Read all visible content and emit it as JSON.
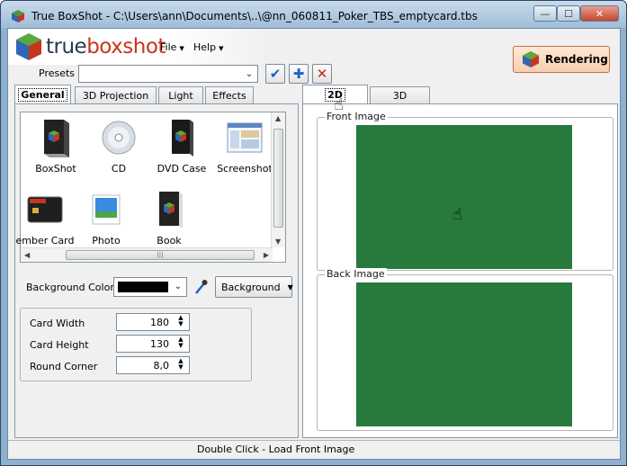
{
  "window": {
    "title": "True BoxShot - C:\\Users\\ann\\Documents\\..\\@nn_060811_Poker_TBS_emptycard.tbs",
    "controls": {
      "minimize": "—",
      "maximize": "☐",
      "close": "✕"
    }
  },
  "logo": {
    "part1": "true",
    "part2": "boxshot"
  },
  "menu": {
    "file": "File",
    "help": "Help"
  },
  "presets": {
    "label": "Presets",
    "value": ""
  },
  "toolbar": {
    "apply_icon": "check-icon",
    "add_icon": "plus-icon",
    "delete_icon": "x-icon"
  },
  "render_button": {
    "label": "Rendering"
  },
  "left_tabs": [
    "General",
    "3D Projection",
    "Light",
    "Effects"
  ],
  "templates": [
    {
      "label": "BoxShot",
      "icon": "boxshot-icon"
    },
    {
      "label": "CD",
      "icon": "cd-icon"
    },
    {
      "label": "DVD Case",
      "icon": "dvd-case-icon"
    },
    {
      "label": "Screenshot",
      "icon": "screenshot-icon"
    },
    {
      "label": "ember Card",
      "icon": "member-card-icon"
    },
    {
      "label": "Photo",
      "icon": "photo-icon"
    },
    {
      "label": "Book",
      "icon": "book-icon"
    }
  ],
  "background": {
    "label": "Background Color",
    "color": "#000000",
    "button_label": "Background"
  },
  "card": {
    "width_label": "Card Width",
    "width_value": "180",
    "height_label": "Card Height",
    "height_value": "130",
    "corner_label": "Round Corner",
    "corner_value": "8,0"
  },
  "right_tabs": [
    "2D",
    "3D"
  ],
  "preview": {
    "front_label": "Front Image",
    "back_label": "Back Image",
    "card_color": "#287a3c"
  },
  "status": {
    "text": "Double Click - Load Front Image"
  }
}
